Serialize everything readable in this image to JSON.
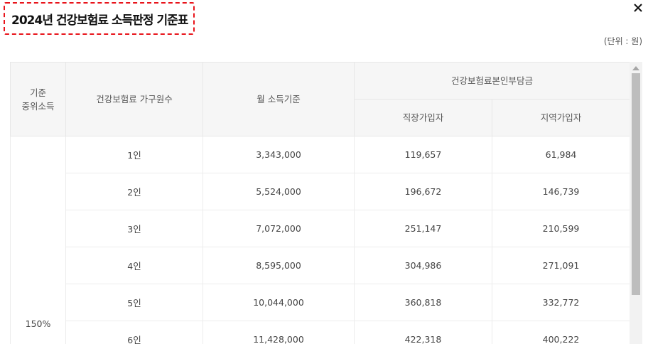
{
  "title": "2024년 건강보험료 소득판정 기준표",
  "unit_label": "(단위 : 원)",
  "table": {
    "headers": {
      "criterion": "기준\n중위소득",
      "household": "건강보험료 가구원수",
      "monthly_income": "월 소득기준",
      "premium_group": "건강보험료본인부담금",
      "employee": "직장가입자",
      "regional": "지역가입자"
    },
    "criterion_value": "150%",
    "rows": [
      {
        "household": "1인",
        "income": "3,343,000",
        "employee": "119,657",
        "regional": "61,984"
      },
      {
        "household": "2인",
        "income": "5,524,000",
        "employee": "196,672",
        "regional": "146,739"
      },
      {
        "household": "3인",
        "income": "7,072,000",
        "employee": "251,147",
        "regional": "210,599"
      },
      {
        "household": "4인",
        "income": "8,595,000",
        "employee": "304,986",
        "regional": "271,091"
      },
      {
        "household": "5인",
        "income": "10,044,000",
        "employee": "360,818",
        "regional": "332,772"
      },
      {
        "household": "6인",
        "income": "11,428,000",
        "employee": "422,318",
        "regional": "400,222"
      }
    ]
  },
  "icons": {
    "close": "close-icon",
    "scroll_up": "arrow-up-icon"
  }
}
